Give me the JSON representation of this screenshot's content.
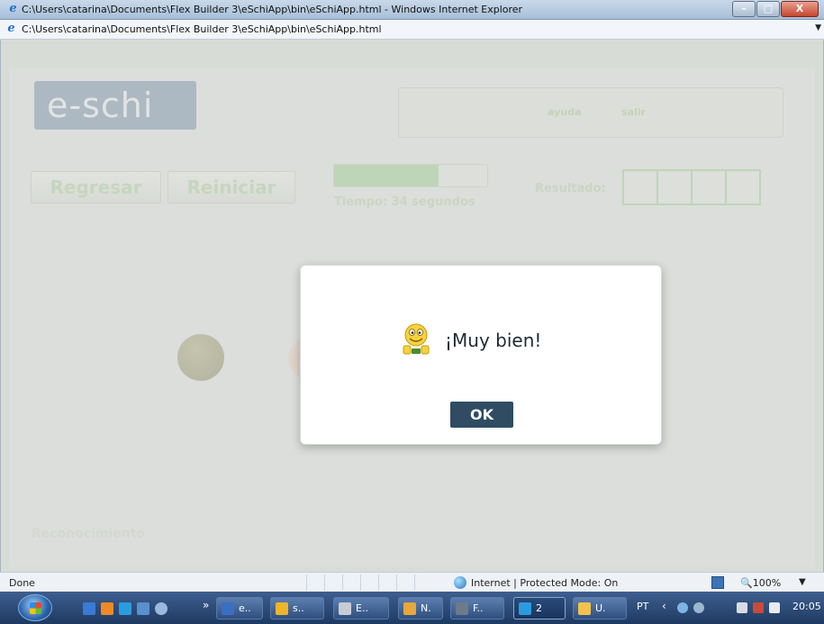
{
  "window": {
    "title": "C:\\Users\\catarina\\Documents\\Flex Builder 3\\eSchiApp\\bin\\eSchiApp.html - Windows Internet Explorer",
    "address": "C:\\Users\\catarina\\Documents\\Flex Builder 3\\eSchiApp\\bin\\eSchiApp.html",
    "controls": {
      "minimize": "",
      "maximize": "",
      "close": "X"
    }
  },
  "app": {
    "logo": "e-schi",
    "menu": {
      "ayuda": "ayuda",
      "salir": "salir"
    },
    "buttons": {
      "regresar": "Regresar",
      "reiniciar": "Reiniciar"
    },
    "timer": {
      "label": "Tiempo: 34 segundos",
      "progress": 0.68
    },
    "resultado_label": "Resultado:",
    "result_slots": 4,
    "footer_label": "Reconocimiento"
  },
  "dialog": {
    "message": "¡Muy bien!",
    "ok_label": "OK",
    "icon": "smiley-icon"
  },
  "statusbar": {
    "status": "Done",
    "zone": "Internet | Protected Mode: On",
    "zoom": "100%"
  },
  "taskbar": {
    "items": [
      {
        "label": "e..",
        "icon": "word-icon"
      },
      {
        "label": "s..",
        "icon": "folder-icon"
      },
      {
        "label": "E..",
        "icon": "app-icon"
      },
      {
        "label": "N.",
        "icon": "notes-icon"
      },
      {
        "label": "F..",
        "icon": "flex-icon"
      },
      {
        "label": "2",
        "icon": "ie-icon"
      },
      {
        "label": "U.",
        "icon": "messenger-icon"
      }
    ],
    "language": "PT",
    "clock": "20:05"
  },
  "colors": {
    "accent_green": "#a8d69a",
    "logo_blue": "#7f97b3",
    "ok_button": "#2f4c63"
  }
}
